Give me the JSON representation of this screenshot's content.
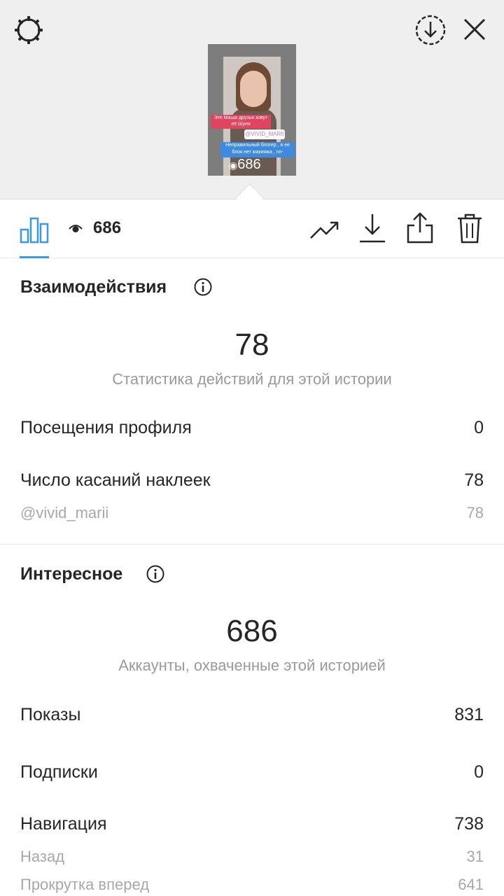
{
  "header": {
    "settings_icon": "gear-icon",
    "download_icon": "download-circle-icon",
    "close_icon": "close-icon"
  },
  "story_preview": {
    "caption_1": "Эте Маша друзья зовут её Шуня",
    "sticker_mention": "@VIVID_MARII",
    "caption_2": "Неправильный блогер , в ее блок нет макияжа , пп-",
    "views": "686"
  },
  "toolbar": {
    "views": "686",
    "icons": [
      "bar-chart-icon",
      "eye-icon",
      "trending-icon",
      "download-icon",
      "share-icon",
      "trash-icon"
    ]
  },
  "interactions": {
    "title": "Взаимодействия",
    "total": "78",
    "total_caption": "Статистика действий для этой истории",
    "rows": [
      {
        "label": "Посещения профиля",
        "value": "0"
      },
      {
        "label": "Число касаний наклеек",
        "value": "78"
      },
      {
        "label": "@vivid_marii",
        "value": "78"
      }
    ]
  },
  "discovery": {
    "title": "Интересное",
    "total": "686",
    "total_caption": "Аккаунты, охваченные этой историей",
    "rows": [
      {
        "label": "Показы",
        "value": "831"
      },
      {
        "label": "Подписки",
        "value": "0"
      },
      {
        "label": "Навигация",
        "value": "738"
      },
      {
        "label": "Назад",
        "value": "31"
      },
      {
        "label": "Прокрутка вперед",
        "value": "641"
      }
    ]
  },
  "colors": {
    "accent": "#3897f0",
    "text": "#262626",
    "muted": "#9a9a9a",
    "header_bg": "#efefef"
  }
}
